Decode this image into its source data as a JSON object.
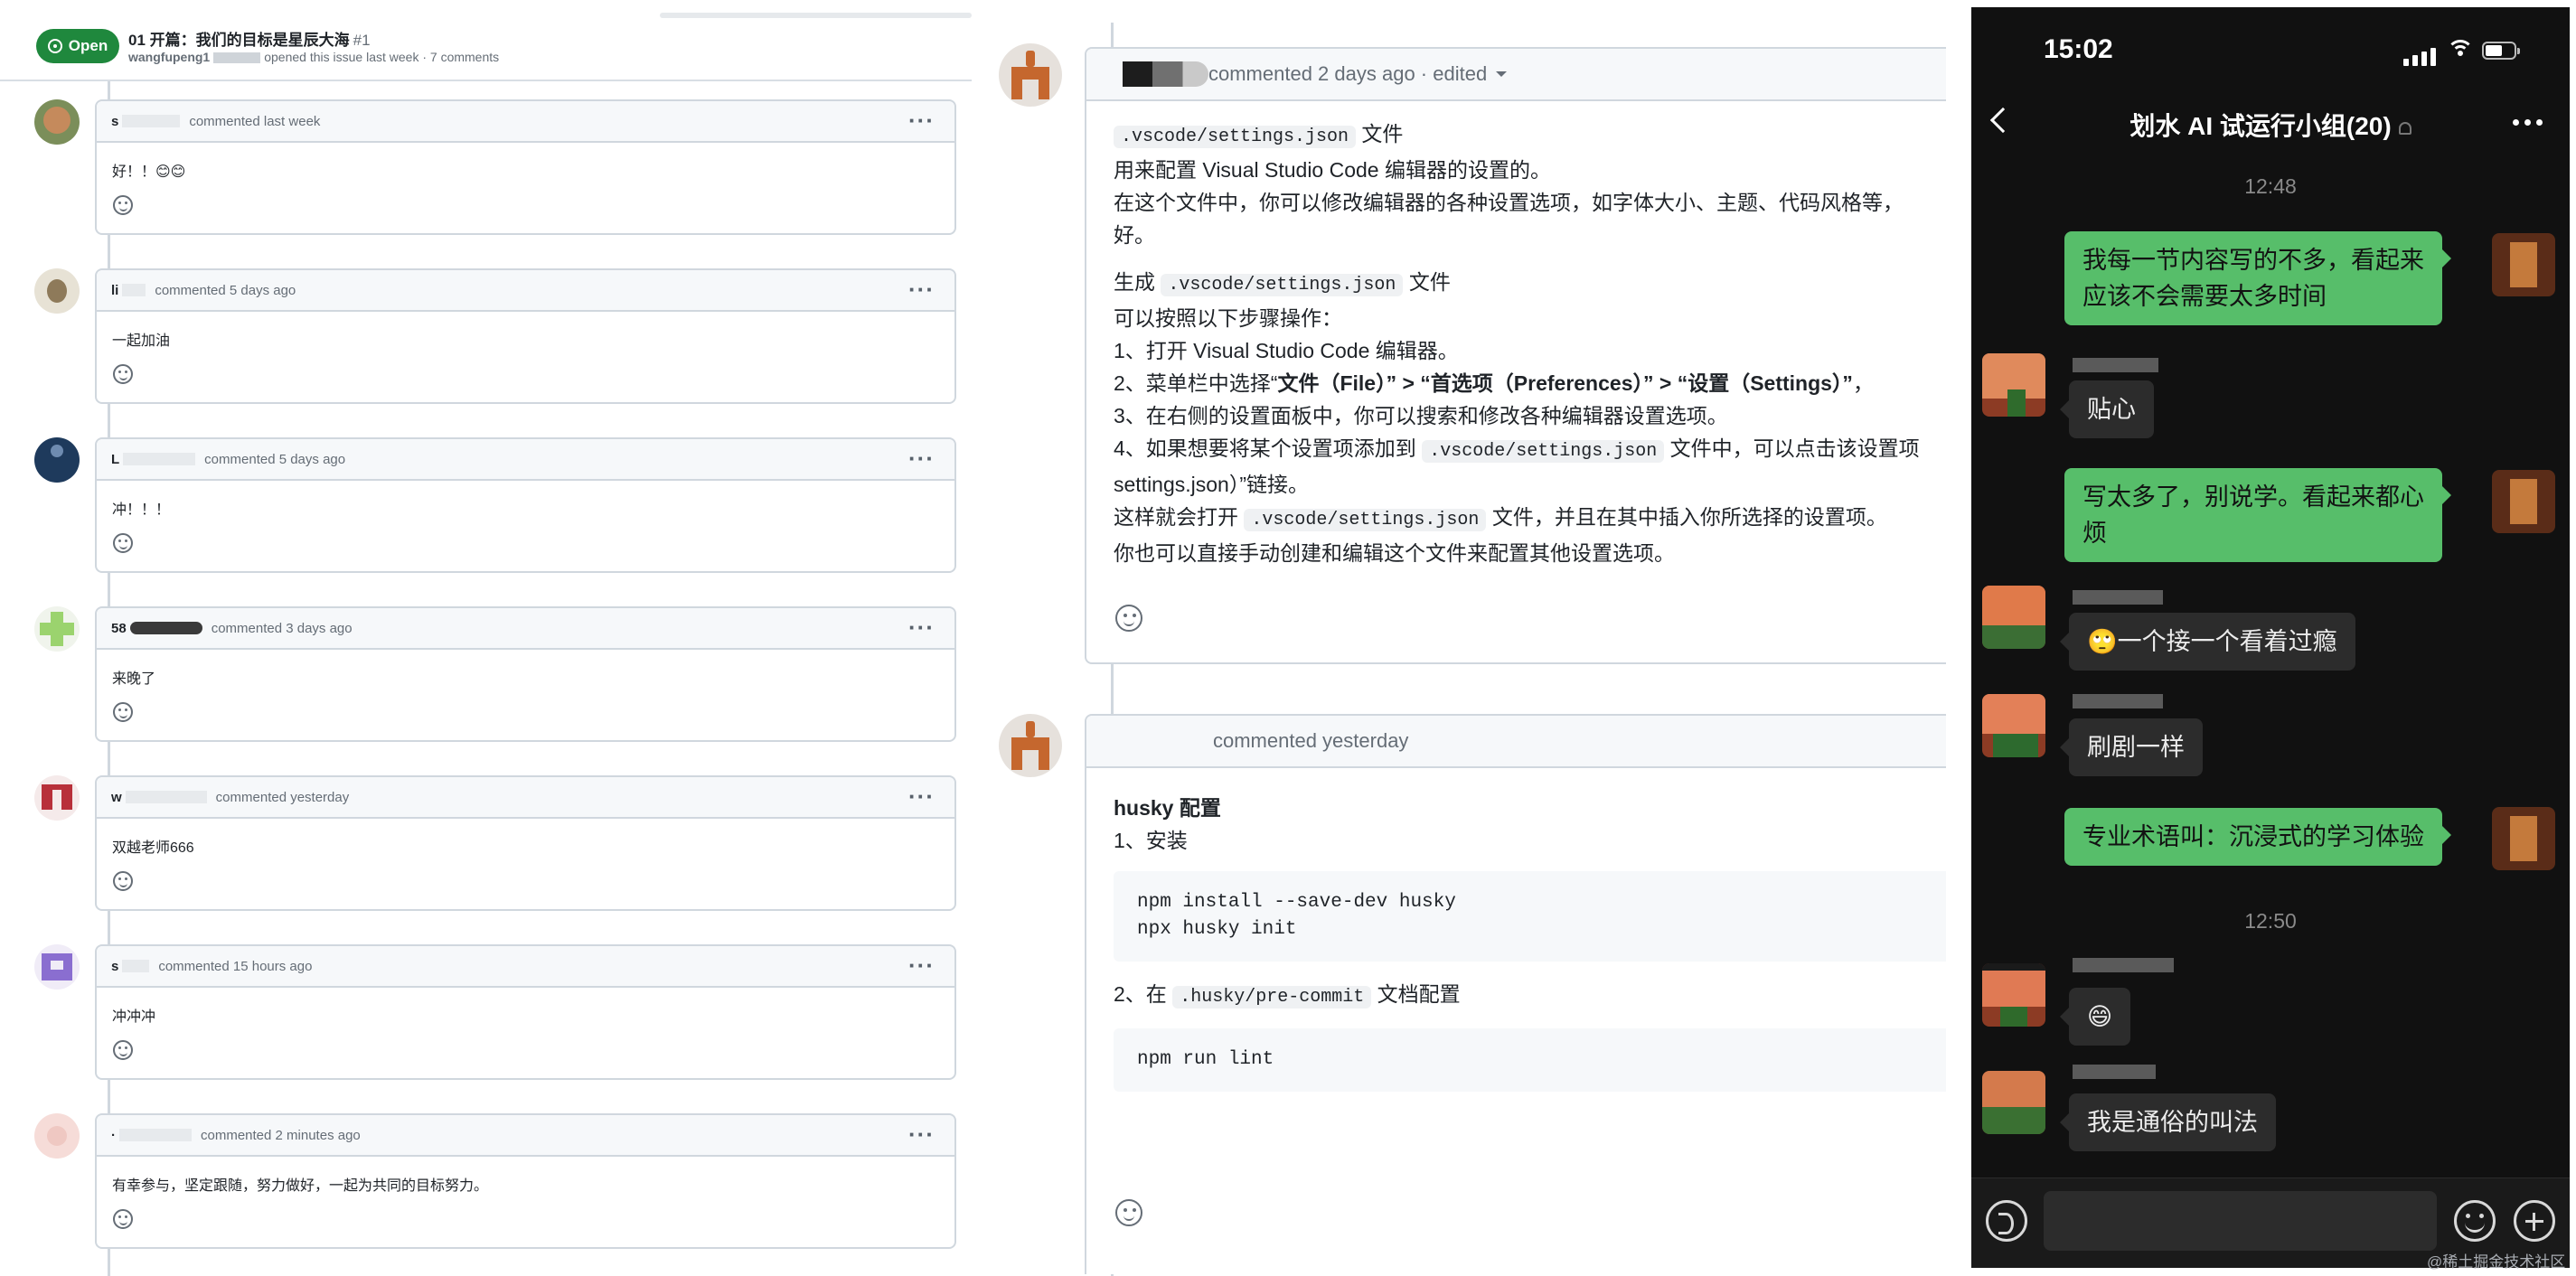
{
  "issue": {
    "badge": "Open",
    "title": "01 开篇：我们的目标是星辰大海",
    "number": "#1",
    "author": "wangfupeng1",
    "meta": "opened this issue last week · 7 comments"
  },
  "comments": [
    {
      "author": "s",
      "time": "commented last week",
      "text": "好！！😊😊"
    },
    {
      "author": "li",
      "time": "commented 5 days ago",
      "text": "一起加油"
    },
    {
      "author": "L",
      "time": "commented 5 days ago",
      "text": "冲！！！"
    },
    {
      "author": "58",
      "time": "commented 3 days ago",
      "text": "来晚了"
    },
    {
      "author": "w",
      "time": "commented yesterday",
      "text": "双越老师666"
    },
    {
      "author": "s",
      "time": "commented 15 hours ago",
      "text": "冲冲冲"
    },
    {
      "author": "·",
      "time": "commented 2 minutes ago",
      "text": "有幸参与，坚定跟随，努力做好，一起为共同的目标努力。"
    }
  ],
  "detail1": {
    "header": "commented 2 days ago · edited",
    "l1_code": ".vscode/settings.json",
    "l1_rest": " 文件",
    "l2": "用来配置 Visual Studio Code 编辑器的设置的。",
    "l3": "在这个文件中，你可以修改编辑器的各种设置选项，如字体大小、主题、代码风格等，",
    "l4": "好。",
    "l5_pre": "生成 ",
    "l5_code": ".vscode/settings.json",
    "l5_rest": " 文件",
    "l6": "可以按照以下步骤操作：",
    "l7": "1、打开 Visual Studio Code 编辑器。",
    "l8_pre": "2、菜单栏中选择“",
    "l8_bold": "文件（File）” > “首选项（Preferences）” > “设置（Settings）”",
    "l8_rest": "，",
    "l9": "3、在右侧的设置面板中，你可以搜索和修改各种编辑器设置选项。",
    "l10_pre": "4、如果想要将某个设置项添加到 ",
    "l10_code": ".vscode/settings.json",
    "l10_rest": " 文件中，可以点击该设置项",
    "l11": "settings.json）”链接。",
    "l12_pre": "这样就会打开 ",
    "l12_code": ".vscode/settings.json",
    "l12_rest": " 文件，并且在其中插入你所选择的设置项。",
    "l13": "你也可以直接手动创建和编辑这个文件来配置其他设置选项。"
  },
  "detail2": {
    "header": "commented yesterday",
    "heading": "husky 配置",
    "step1": "1、安装",
    "code1_l1": "npm install --save-dev husky",
    "code1_l2": "npx husky init",
    "step2_pre": "2、在 ",
    "step2_code": ".husky/pre-commit",
    "step2_rest": " 文档配置",
    "code2": "npm run lint"
  },
  "phone": {
    "time": "15:02",
    "chat_title": "划水 AI 试运行小组(20)",
    "ts1": "12:48",
    "ts2": "12:50",
    "msgs": [
      {
        "from": "me",
        "line1": "我每一节内容写的不多，看起来",
        "line2": "应该不会需要太多时间"
      },
      {
        "from": "other",
        "text": "贴心"
      },
      {
        "from": "me",
        "line1": "写太多了，别说学。看起来都心",
        "line2": "烦"
      },
      {
        "from": "other",
        "text": "🙄一个接一个看着过瘾"
      },
      {
        "from": "other",
        "text": "刷剧一样"
      },
      {
        "from": "me",
        "text": "专业术语叫：沉浸式的学习体验"
      },
      {
        "from": "other",
        "text": "😄"
      },
      {
        "from": "other",
        "text": "我是通俗的叫法"
      }
    ]
  },
  "watermark": "@稀土掘金技术社区"
}
